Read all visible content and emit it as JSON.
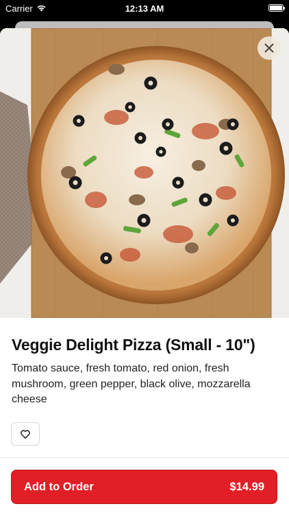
{
  "status_bar": {
    "carrier": "Carrier",
    "time": "12:13 AM",
    "icons": [
      "wifi-icon",
      "battery-icon"
    ]
  },
  "product": {
    "image_subject": "pizza-photo",
    "title": "Veggie Delight Pizza (Small - 10\")",
    "description": "Tomato sauce, fresh tomato, red onion, fresh mushroom, green pepper, black olive, mozzarella cheese"
  },
  "actions": {
    "close_icon": "close-icon",
    "favorite_icon": "heart-icon",
    "add_label": "Add to Order",
    "price": "$14.99"
  },
  "colors": {
    "accent": "#e11f26",
    "text": "#111111"
  }
}
